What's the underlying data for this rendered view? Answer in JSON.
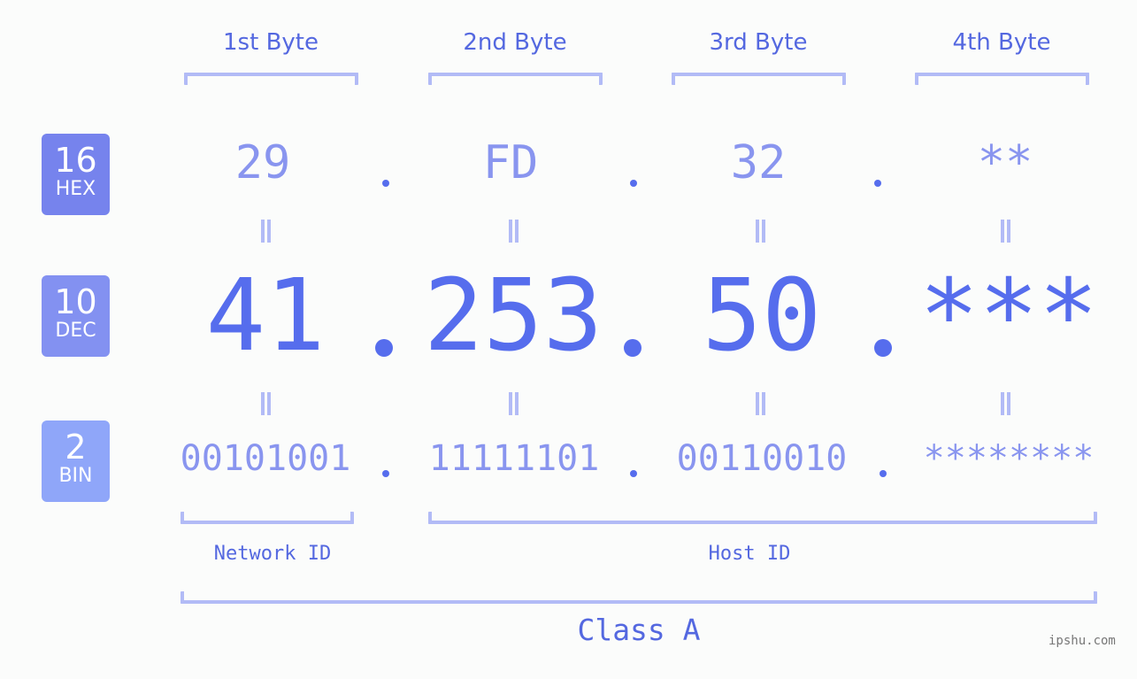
{
  "byte_headers": [
    "1st Byte",
    "2nd Byte",
    "3rd Byte",
    "4th Byte"
  ],
  "badges": {
    "hex": {
      "base": "16",
      "label": "HEX",
      "color": "#7683ed"
    },
    "dec": {
      "base": "10",
      "label": "DEC",
      "color": "#8391f1"
    },
    "bin": {
      "base": "2",
      "label": "BIN",
      "color": "#8fa6f9"
    }
  },
  "ip": {
    "hex": [
      "29",
      "FD",
      "32",
      "**"
    ],
    "dec": [
      "41",
      "253",
      "50",
      "***"
    ],
    "bin": [
      "00101001",
      "11111101",
      "00110010",
      "********"
    ]
  },
  "segments": {
    "network_id": "Network ID",
    "host_id": "Host ID",
    "class": "Class A"
  },
  "watermark": "ipshu.com",
  "colors": {
    "primary": "#566ded",
    "secondary": "#8995ef",
    "bracket": "#b2bbf6",
    "label": "#5468e0"
  }
}
